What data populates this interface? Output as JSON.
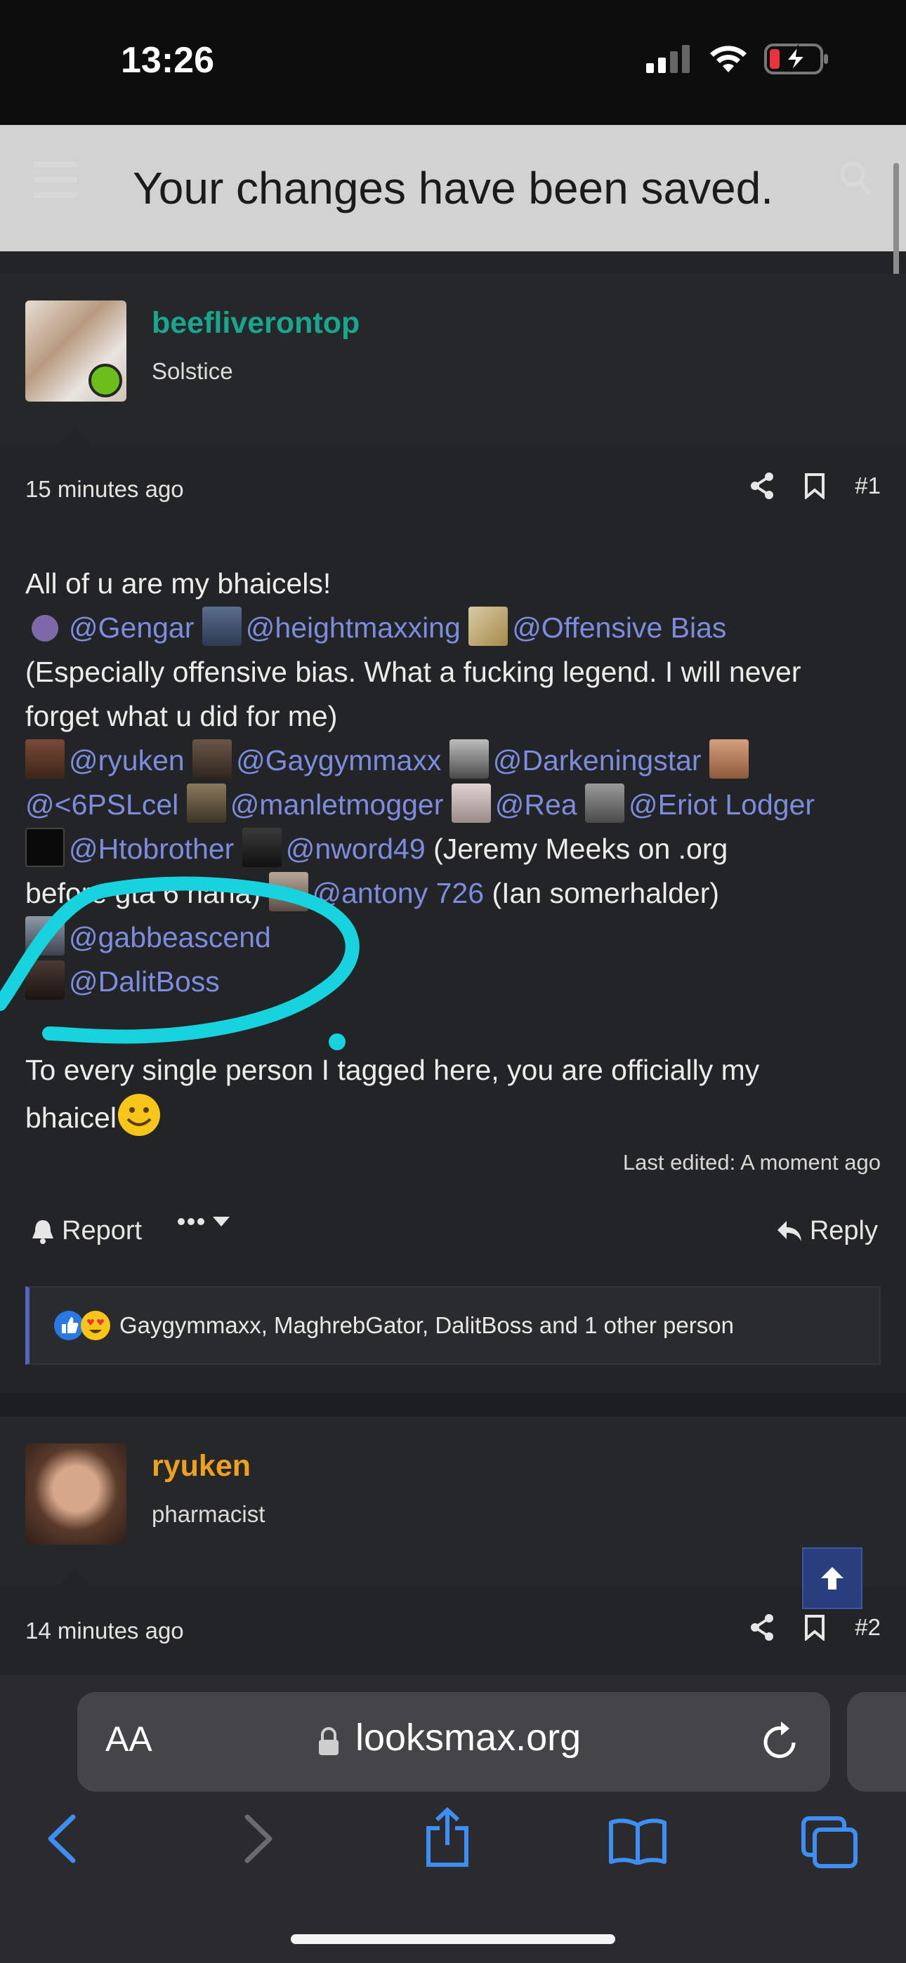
{
  "status_bar": {
    "time": "13:26"
  },
  "toast": {
    "message": "Your changes have been saved."
  },
  "post1": {
    "username": "beefliverontop",
    "user_title": "Solstice",
    "timestamp": "15 minutes ago",
    "post_number": "#1",
    "lines": {
      "l1": "All of u are my bhaicels!",
      "gengar": "@Gengar",
      "heightmaxxing": "@heightmaxxing",
      "offensive": "@Offensive Bias",
      "l3": "(Especially offensive bias. What a fucking legend. I will never",
      "l4": "forget what u did for me)",
      "ryuken": "@ryuken",
      "gaygym": "@Gaygymmaxx",
      "darkening": "@Darkeningstar",
      "psl": "@<6PSLcel",
      "manlet": "@manletmogger",
      "rea": "@Rea",
      "eriot": "@Eriot Lodger",
      "htobrother": "@Htobrother",
      "nword": "@nword49",
      "meeks": "(Jeremy Meeks on .org",
      "before": "before gta 6 haha)",
      "antony": "@antony 726",
      "ian": "(Ian somerhalder)",
      "gabbe": "@gabbeascend",
      "dalit": "@DalitBoss",
      "final": "To every single person I tagged here, you are officially my",
      "final2": "bhaicel"
    },
    "edited": "Last edited: A moment ago",
    "report_label": "Report",
    "reply_label": "Reply",
    "reactions_text": "Gaygymmaxx, MaghrebGator, DalitBoss and 1 other person"
  },
  "post2": {
    "username": "ryuken",
    "user_title": "pharmacist",
    "timestamp": "14 minutes ago",
    "post_number": "#2"
  },
  "browser": {
    "text_size_label": "AA",
    "url": "looksmax.org"
  },
  "colors": {
    "username_teal": "#1aa68e",
    "username_orange": "#f0a020",
    "mention": "#7d8be0",
    "annotation": "#16d3dd"
  },
  "icons": [
    "share-icon",
    "bookmark-icon",
    "bell-icon",
    "reply-icon",
    "lock-icon",
    "reload-icon",
    "back-icon",
    "forward-icon",
    "share-sheet-icon",
    "bookmarks-icon",
    "tabs-icon",
    "arrow-up-icon"
  ]
}
